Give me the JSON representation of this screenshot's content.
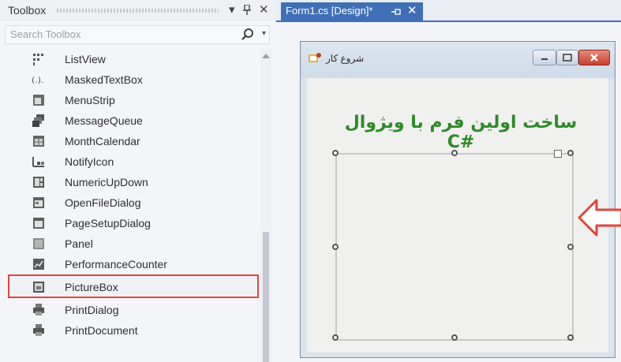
{
  "toolbox": {
    "title": "Toolbox",
    "pin_glyph": "▾ ᵽ ✕",
    "search_placeholder": "Search Toolbox",
    "items": [
      {
        "label": "ListView",
        "icon": "listview-icon"
      },
      {
        "label": "MaskedTextBox",
        "icon": "maskedtextbox-icon"
      },
      {
        "label": "MenuStrip",
        "icon": "menustrip-icon"
      },
      {
        "label": "MessageQueue",
        "icon": "messagequeue-icon"
      },
      {
        "label": "MonthCalendar",
        "icon": "monthcalendar-icon"
      },
      {
        "label": "NotifyIcon",
        "icon": "notifyicon-icon"
      },
      {
        "label": "NumericUpDown",
        "icon": "numericupdown-icon"
      },
      {
        "label": "OpenFileDialog",
        "icon": "openfiledialog-icon"
      },
      {
        "label": "PageSetupDialog",
        "icon": "pagesetupdialog-icon"
      },
      {
        "label": "Panel",
        "icon": "panel-icon"
      },
      {
        "label": "PerformanceCounter",
        "icon": "performancecounter-icon"
      },
      {
        "label": "PictureBox",
        "icon": "picturebox-icon",
        "selected": true
      },
      {
        "label": "PrintDialog",
        "icon": "printdialog-icon"
      },
      {
        "label": "PrintDocument",
        "icon": "printdocument-icon"
      }
    ]
  },
  "designer": {
    "tab_label": "Form1.cs [Design]*",
    "form_title": "شروع کار",
    "form_heading": "ساخت اولین فرم با ویژوال #C"
  },
  "colors": {
    "selection_outline": "#e0463a",
    "tab_active": "#3f6fb6",
    "heading_green": "#2f8a2a",
    "arrow_outline": "#e0463a"
  }
}
